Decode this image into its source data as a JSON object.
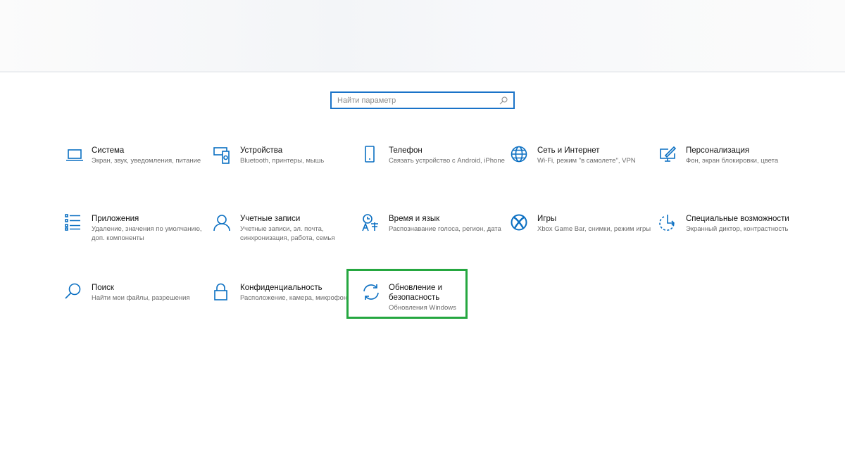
{
  "search": {
    "placeholder": "Найти параметр",
    "icon": "search-icon"
  },
  "tiles": [
    {
      "title": "Система",
      "desc": "Экран, звук, уведомления, питание",
      "icon": "laptop-icon"
    },
    {
      "title": "Устройства",
      "desc": "Bluetooth, принтеры, мышь",
      "icon": "devices-icon"
    },
    {
      "title": "Телефон",
      "desc": "Связать устройство с Android, iPhone",
      "icon": "phone-icon"
    },
    {
      "title": "Сеть и Интернет",
      "desc": "Wi-Fi, режим \"в самолете\", VPN",
      "icon": "globe-icon"
    },
    {
      "title": "Персонализация",
      "desc": "Фон, экран блокировки, цвета",
      "icon": "personalization-icon"
    },
    {
      "title": "Приложения",
      "desc": "Удаление, значения по умолчанию, доп. компоненты",
      "icon": "apps-list-icon"
    },
    {
      "title": "Учетные записи",
      "desc": "Учетные записи, эл. почта, синхронизация, работа, семья",
      "icon": "person-icon"
    },
    {
      "title": "Время и язык",
      "desc": "Распознавание голоса, регион, дата",
      "icon": "time-language-icon"
    },
    {
      "title": "Игры",
      "desc": "Xbox Game Bar, снимки, режим игры",
      "icon": "xbox-icon"
    },
    {
      "title": "Специальные возможности",
      "desc": "Экранный диктор, контрастность",
      "icon": "accessibility-icon"
    },
    {
      "title": "Поиск",
      "desc": "Найти мои файлы, разрешения",
      "icon": "search-icon"
    },
    {
      "title": "Конфиденциальность",
      "desc": "Расположение, камера, микрофон",
      "icon": "lock-icon"
    },
    {
      "title": "Обновление и безопасность",
      "desc": "Обновления Windows",
      "icon": "sync-icon"
    }
  ],
  "colors": {
    "accent": "#0a6fc2",
    "highlight": "#25a740"
  }
}
